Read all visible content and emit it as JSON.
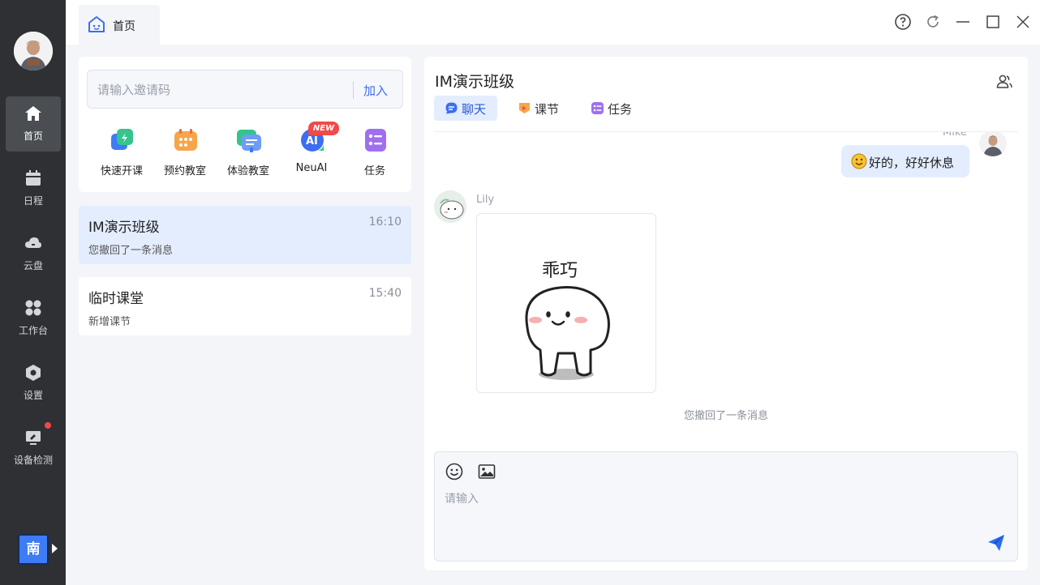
{
  "nav": {
    "items": [
      {
        "label": "首页",
        "icon": "home-icon"
      },
      {
        "label": "日程",
        "icon": "calendar-icon"
      },
      {
        "label": "云盘",
        "icon": "cloud-icon"
      },
      {
        "label": "工作台",
        "icon": "grid-icon"
      },
      {
        "label": "设置",
        "icon": "gear-icon"
      },
      {
        "label": "设备检测",
        "icon": "monitor-icon"
      }
    ],
    "ime_label": "南"
  },
  "topbar": {
    "tab_label": "首页"
  },
  "join": {
    "placeholder": "请输入邀请码",
    "button": "加入"
  },
  "quick_actions": [
    {
      "label": "快速开课",
      "icon": "quick-class-icon"
    },
    {
      "label": "预约教室",
      "icon": "reserve-room-icon"
    },
    {
      "label": "体验教室",
      "icon": "trial-room-icon"
    },
    {
      "label": "NeuAI",
      "icon": "ai-icon",
      "badge": "NEW"
    },
    {
      "label": "任务",
      "icon": "task-icon"
    }
  ],
  "conversations": [
    {
      "name": "IM演示班级",
      "time": "16:10",
      "preview": "您撤回了一条消息"
    },
    {
      "name": "临时课堂",
      "time": "15:40",
      "preview": "新增课节"
    }
  ],
  "chat": {
    "title": "IM演示班级",
    "tabs": [
      {
        "label": "聊天",
        "icon": "chat-icon"
      },
      {
        "label": "课节",
        "icon": "lesson-icon"
      },
      {
        "label": "任务",
        "icon": "task-icon"
      }
    ],
    "messages": {
      "me_name": "Mike",
      "me_text": "好的，好好休息",
      "other_name": "Lily",
      "sticker_text": "乖巧",
      "recall_notice": "您撤回了一条消息"
    },
    "composer_placeholder": "请输入"
  },
  "colors": {
    "accent": "#3d6ef0",
    "nav_bg": "#2e3033",
    "active_bg": "#e3edfe"
  }
}
